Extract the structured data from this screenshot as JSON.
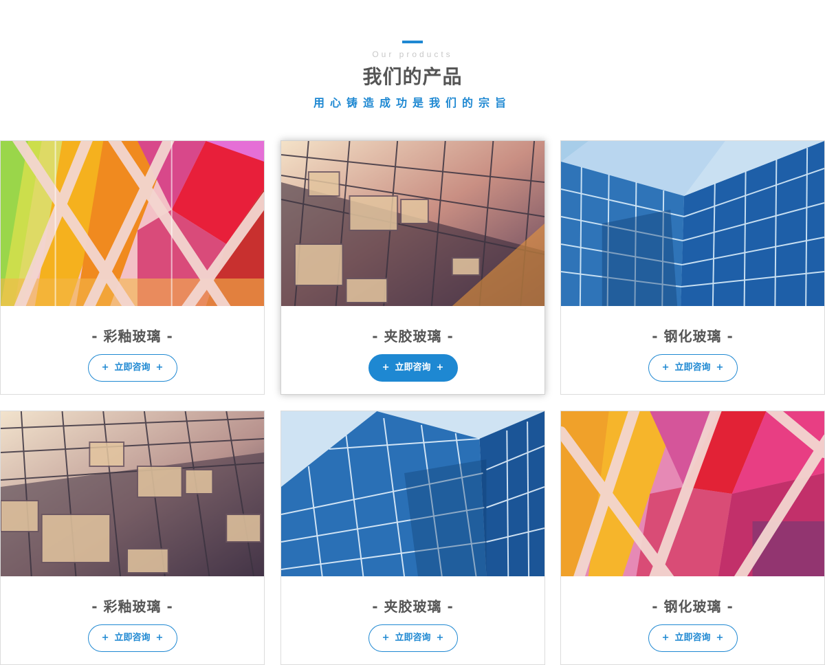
{
  "header": {
    "eyebrow": "Our products",
    "title": "我们的产品",
    "subtitle": "用心铸造成功是我们的宗旨"
  },
  "products": [
    {
      "name": "- 彩釉玻璃 -",
      "button_label": "立即咨询",
      "plus": "+",
      "image": "colored-glass"
    },
    {
      "name": "- 夹胶玻璃 -",
      "button_label": "立即咨询",
      "plus": "+",
      "image": "atrium-skylight"
    },
    {
      "name": "- 钢化玻璃 -",
      "button_label": "立即咨询",
      "plus": "+",
      "image": "blue-curtain-wall"
    },
    {
      "name": "- 彩釉玻璃 -",
      "button_label": "立即咨询",
      "plus": "+",
      "image": "atrium-skylight"
    },
    {
      "name": "- 夹胶玻璃 -",
      "button_label": "立即咨询",
      "plus": "+",
      "image": "blue-curtain-wall"
    },
    {
      "name": "- 钢化玻璃 -",
      "button_label": "立即咨询",
      "plus": "+",
      "image": "colored-glass"
    }
  ],
  "colors": {
    "accent": "#1e88d2",
    "text": "#555555",
    "border": "#dcdcdc"
  }
}
